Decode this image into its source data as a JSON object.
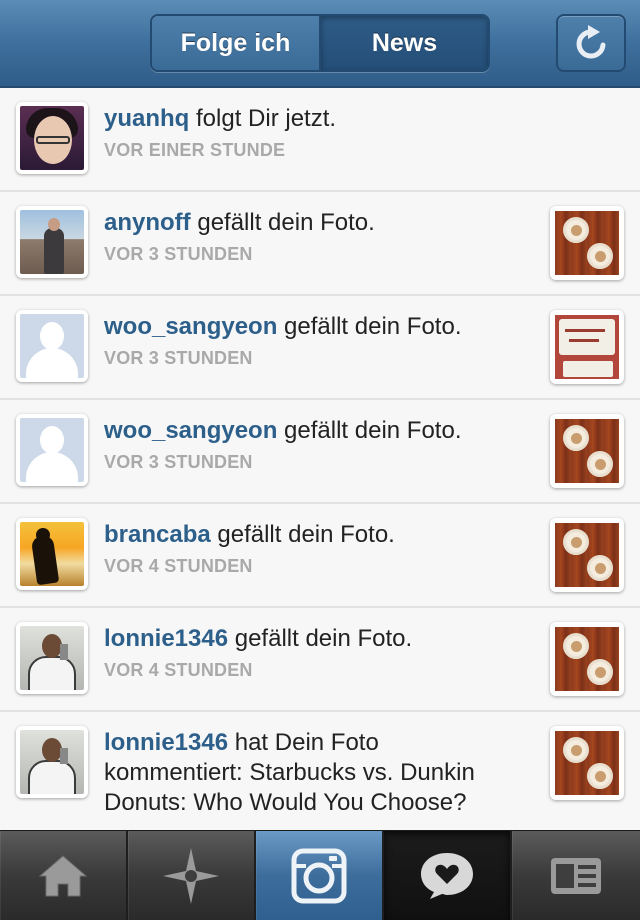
{
  "header": {
    "segments": [
      {
        "label": "Folge ich",
        "selected": false
      },
      {
        "label": "News",
        "selected": true
      }
    ],
    "refresh_icon": "refresh-icon"
  },
  "feed": [
    {
      "user": "yuanhq",
      "action": " folgt Dir jetzt.",
      "time": "VOR EINER STUNDE",
      "avatar": "yuanhq",
      "thumb": null
    },
    {
      "user": "anynoff",
      "action": " gefällt dein Foto.",
      "time": "VOR 3 STUNDEN",
      "avatar": "anynoff",
      "thumb": "coffee"
    },
    {
      "user": "woo_sangyeon",
      "action": " gefällt dein Foto.",
      "time": "VOR 3 STUNDEN",
      "avatar": "default",
      "thumb": "sign"
    },
    {
      "user": "woo_sangyeon",
      "action": " gefällt dein Foto.",
      "time": "VOR 3 STUNDEN",
      "avatar": "default",
      "thumb": "coffee"
    },
    {
      "user": "brancaba",
      "action": " gefällt dein Foto.",
      "time": "VOR 4 STUNDEN",
      "avatar": "brancaba",
      "thumb": "coffee"
    },
    {
      "user": "lonnie1346",
      "action": " gefällt dein Foto.",
      "time": "VOR 4 STUNDEN",
      "avatar": "lonnie",
      "thumb": "coffee"
    },
    {
      "user": "lonnie1346",
      "action": " hat Dein Foto kommentiert: Starbucks vs. Dunkin Donuts: Who Would You Choose?",
      "time": "",
      "avatar": "lonnie",
      "thumb": "coffee"
    }
  ],
  "tabbar": {
    "tabs": [
      {
        "icon": "home-icon",
        "active": false
      },
      {
        "icon": "explore-icon",
        "active": false
      },
      {
        "icon": "camera-icon",
        "active": false
      },
      {
        "icon": "news-heart-icon",
        "active": true
      },
      {
        "icon": "profile-icon",
        "active": false
      }
    ]
  },
  "colors": {
    "header_blue": "#3f6f9c",
    "username_blue": "#2d5f8b",
    "time_gray": "#a9a9a9"
  }
}
